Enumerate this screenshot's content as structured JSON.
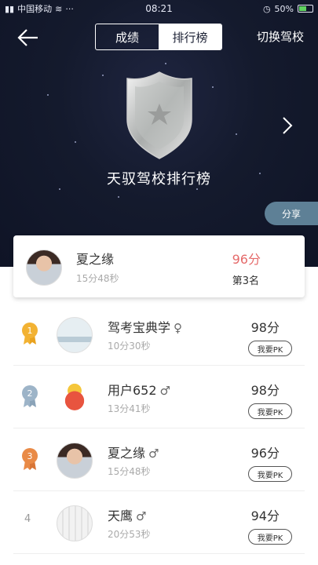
{
  "status_bar": {
    "carrier": "中国移动",
    "time": "08:21",
    "battery": "50%"
  },
  "header": {
    "tabs": [
      {
        "label": "成绩",
        "active": false
      },
      {
        "label": "排行榜",
        "active": true
      }
    ],
    "switch_school": "切换驾校"
  },
  "hero": {
    "title": "天驭驾校排行榜",
    "share": "分享"
  },
  "my_rank": {
    "name": "夏之缘",
    "time": "15分48秒",
    "score": "96分",
    "rank": "第3名"
  },
  "leaderboard": [
    {
      "rank": "1",
      "medal": "gold",
      "name": "驾考宝典学",
      "gender": "♀",
      "time": "10分30秒",
      "score": "98分",
      "pk": "我要PK"
    },
    {
      "rank": "2",
      "medal": "silver",
      "name": "用户652",
      "gender": "♂",
      "time": "13分41秒",
      "score": "98分",
      "pk": "我要PK"
    },
    {
      "rank": "3",
      "medal": "bronze",
      "name": "夏之缘",
      "gender": "♂",
      "time": "15分48秒",
      "score": "96分",
      "pk": "我要PK"
    },
    {
      "rank": "4",
      "medal": "none",
      "name": "天鹰",
      "gender": "♂",
      "time": "20分53秒",
      "score": "94分",
      "pk": "我要PK"
    }
  ],
  "colors": {
    "hero_bg": "#141a2d",
    "score_accent": "#e56a6a",
    "share_btn": "#5e8096",
    "gold": "#f2b233",
    "silver": "#9db4c8",
    "bronze": "#e98a46"
  }
}
